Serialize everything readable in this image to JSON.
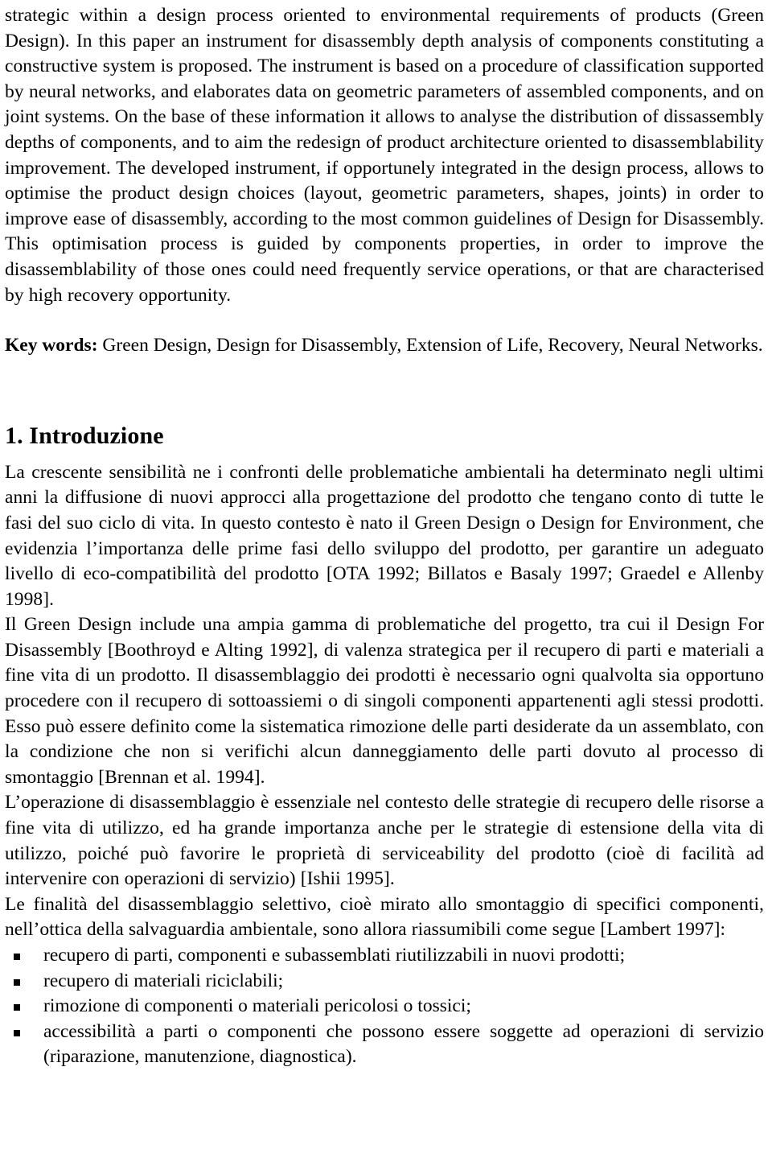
{
  "document": {
    "language": "it",
    "background_color": "#ffffff",
    "text_color": "#000000"
  },
  "abstract": {
    "continued_text": "strategic within a design process oriented to environmental requirements of products (Green Design). In this paper an instrument for disassembly depth analysis of components constituting a constructive system is proposed. The instrument is based on a procedure of classification supported by neural networks, and elaborates data on geometric parameters of assembled components, and on joint systems. On the base of these information it allows to analyse the distribution of dissassembly depths of components, and to aim the redesign of product architecture oriented to disassemblability improvement. The developed instrument, if opportunely integrated in the design process, allows to optimise the product design choices (layout, geometric parameters, shapes, joints) in order to improve ease of disassembly, according to the most common guidelines of Design for Disassembly. This optimisation process is guided by components properties, in order to improve the disassemblability of those ones could need frequently service operations, or that are characterised by high recovery opportunity."
  },
  "keywords": {
    "label": "Key words:",
    "value": " Green Design, Design for Disassembly, Extension of Life, Recovery, Neural Networks."
  },
  "section": {
    "heading": "1. Introduzione",
    "paragraphs": [
      "La crescente sensibilità ne i confronti delle problematiche ambientali ha determinato negli ultimi anni la diffusione di nuovi approcci alla progettazione del prodotto che tengano conto di tutte le fasi del suo ciclo di vita. In questo contesto è nato il Green Design o Design for Environment, che evidenzia l’importanza delle prime fasi dello sviluppo del prodotto, per garantire un adeguato livello di eco-compatibilità del prodotto [OTA 1992; Billatos e Basaly 1997; Graedel e Allenby 1998].",
      "Il Green Design include una ampia gamma di problematiche del progetto, tra cui il Design For Disassembly [Boothroyd e Alting 1992], di valenza strategica per il recupero di parti e materiali a fine vita di un prodotto. Il disassemblaggio dei prodotti è necessario ogni qualvolta sia opportuno procedere con il recupero di sottoassiemi o di singoli componenti appartenenti agli stessi prodotti. Esso può essere definito come la sistematica rimozione delle parti desiderate da un assemblato, con la condizione che non si verifichi alcun danneggiamento delle parti dovuto al processo di smontaggio [Brennan et al. 1994].",
      "L’operazione di disassemblaggio è essenziale nel contesto delle strategie di recupero delle risorse a fine vita di utilizzo, ed ha grande importanza anche per le strategie di estensione della vita di utilizzo, poiché può favorire le proprietà di serviceability del prodotto (cioè di facilità ad intervenire con operazioni di servizio) [Ishii 1995].",
      "Le finalità del disassemblaggio selettivo, cioè mirato allo smontaggio di specifici componenti, nell’ottica della salvaguardia ambientale, sono allora riassumibili come segue [Lambert 1997]:"
    ],
    "bullets": [
      "recupero di parti, componenti e subassemblati riutilizzabili in nuovi prodotti;",
      "recupero di materiali riciclabili;",
      "rimozione di componenti o materiali pericolosi o tossici;",
      "accessibilità a parti o componenti che possono essere soggette ad operazioni di servizio (riparazione, manutenzione, diagnostica)."
    ]
  }
}
